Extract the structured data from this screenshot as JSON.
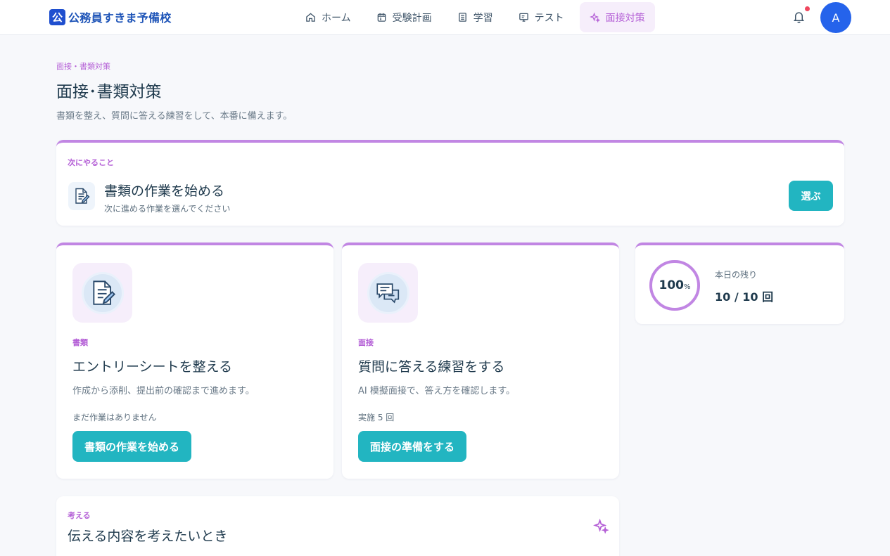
{
  "header": {
    "logo_mark": "公",
    "logo_text": "公務員すきま予備校",
    "nav": [
      {
        "label": "ホーム",
        "icon": "home-icon"
      },
      {
        "label": "受験計画",
        "icon": "calendar-icon"
      },
      {
        "label": "学習",
        "icon": "book-icon"
      },
      {
        "label": "テスト",
        "icon": "monitor-icon"
      },
      {
        "label": "面接対策",
        "icon": "sparkle-icon",
        "active": true
      }
    ],
    "avatar_initial": "A",
    "notification_dot": true
  },
  "page": {
    "breadcrumb": "面接・書類対策",
    "title": "面接･書類対策",
    "description": "書類を整え、質問に答える練習をして、本番に備えます。"
  },
  "next_action": {
    "label": "次にやること",
    "title": "書類の作業を始める",
    "subtitle": "次に進める作業を選んでください",
    "button": "選ぶ",
    "icon": "document-edit-icon"
  },
  "tasks": [
    {
      "category": "書類",
      "title": "エントリーシートを整える",
      "description": "作成から添削、提出前の確認まで進めます。",
      "status": "まだ作業はありません",
      "button": "書類の作業を始める",
      "icon": "document-edit-icon"
    },
    {
      "category": "面接",
      "title": "質問に答える練習をする",
      "description": "AI 模擬面接で、答え方を確認します。",
      "status": "実施 5 回",
      "button": "面接の準備をする",
      "icon": "chat-bubbles-icon"
    }
  ],
  "remaining": {
    "percent_value": "100",
    "percent_unit": "%",
    "percent_fraction": 1.0,
    "label": "本日の残り",
    "value": "10 / 10 回"
  },
  "think": {
    "label": "考える",
    "title": "伝える内容を考えたいとき",
    "icon": "sparkle-icon"
  },
  "colors": {
    "accent_purple": "#b45fd6",
    "card_border": "#c186e3",
    "teal": "#22b5c1",
    "avatar_blue": "#2563eb",
    "logo_blue": "#1f4fcf",
    "notification_red": "#f0475e"
  }
}
